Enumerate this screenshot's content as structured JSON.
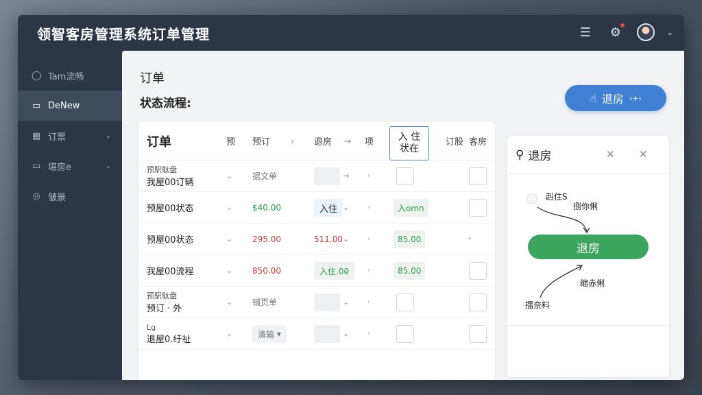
{
  "app": {
    "title": "领智客房管理系统订单管理"
  },
  "topbar": {
    "menu_icon": "list-icon",
    "gear_icon": "gear-icon",
    "avatar": "user-avatar"
  },
  "sidebar": {
    "items": [
      {
        "label": "Tam流畅",
        "icon": "circle-icon"
      },
      {
        "label": "DeNew",
        "icon": "calendar-icon"
      },
      {
        "label": "订票",
        "icon": "building-icon"
      },
      {
        "label": "堪房e",
        "icon": "bed-icon"
      },
      {
        "label": "皱景",
        "icon": "shield-icon"
      }
    ]
  },
  "header": {
    "title": "订单",
    "subtitle": "状态流程:",
    "checkout_button": "退房",
    "checkout_suffix": "›+›"
  },
  "orders": {
    "title": "订单",
    "columns": {
      "c1": "预",
      "c2": "预订",
      "c3": "退房",
      "c4": "项",
      "c5": "入 住\n状在",
      "c6": "订股",
      "c7": "客房"
    },
    "rows": [
      {
        "pre": "预駅駄盘",
        "name": "我屋00订辆",
        "v1": "据文单",
        "v1_color": "gray",
        "mid": "",
        "mid_type": "box",
        "right": "",
        "right_type": "check"
      },
      {
        "pre": "",
        "name": "预屋00状态",
        "v1": "$40.00",
        "v1_color": "green",
        "mid": "入住",
        "mid_type": "pill",
        "right": "入omn",
        "right_type": "tag"
      },
      {
        "pre": "",
        "name": "预屋00状态",
        "v1": "295.00",
        "v1_color": "red",
        "mid": "511.00",
        "mid_type": "redtext",
        "right": "85.00",
        "right_type": "tag"
      },
      {
        "pre": "",
        "name": "我屋00流程",
        "v1": "850.00",
        "v1_color": "red",
        "mid": "入住.00",
        "mid_type": "pillg",
        "right": "85.00",
        "right_type": "tag"
      },
      {
        "pre": "预駅駄盘",
        "name": "预订 · 外",
        "v1": "铺页单",
        "v1_color": "gray",
        "mid": "",
        "mid_type": "box",
        "right": "",
        "right_type": "check"
      },
      {
        "pre": "Lg",
        "name": "退屋0.纡祉",
        "v1": "清输",
        "v1_color": "graypill",
        "mid": "",
        "mid_type": "box",
        "right": "",
        "right_type": "check"
      }
    ]
  },
  "flow": {
    "title": "退房",
    "node_top": "赳住S",
    "node_top_sub": "捌你俐",
    "main_button": "退房",
    "node_bottom": "缩赤俐",
    "node_left": "擂奈料"
  },
  "colors": {
    "primary": "#3f7fd4",
    "success": "#3ba55d",
    "danger": "#d03a3a"
  }
}
